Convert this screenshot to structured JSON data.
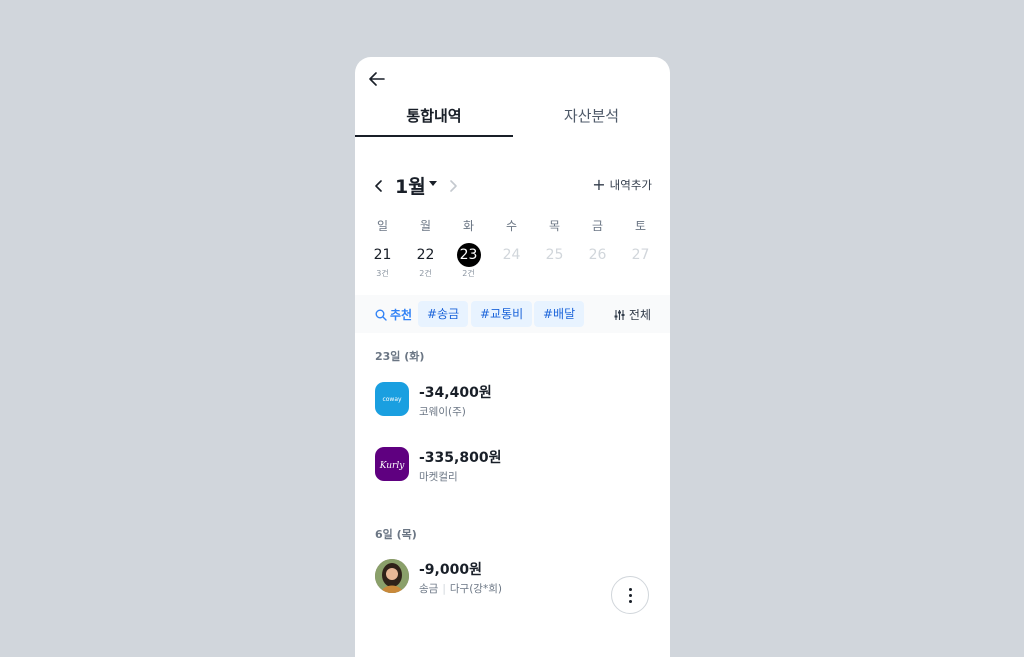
{
  "tabs": [
    {
      "label": "통합내역"
    },
    {
      "label": "자산분석"
    }
  ],
  "month": {
    "label": "1월",
    "add_label": "내역추가"
  },
  "weekdays": [
    "일",
    "월",
    "화",
    "수",
    "목",
    "금",
    "토"
  ],
  "days": [
    {
      "num": "21",
      "count": "3건"
    },
    {
      "num": "22",
      "count": "2건"
    },
    {
      "num": "23",
      "count": "2건"
    },
    {
      "num": "24",
      "count": ""
    },
    {
      "num": "25",
      "count": ""
    },
    {
      "num": "26",
      "count": ""
    },
    {
      "num": "27",
      "count": ""
    }
  ],
  "filters": {
    "recommend": "추천",
    "chips": [
      "#송금",
      "#교통비",
      "#배달"
    ],
    "all": "전체"
  },
  "sections": [
    {
      "date": "23일 (화)",
      "items": [
        {
          "amount": "-34,400원",
          "merchant": "코웨이(주)",
          "logo_text": "coway",
          "logo_color": "#1a9fe0"
        },
        {
          "amount": "-335,800원",
          "merchant": "마켓컬리",
          "logo_text": "Kurly",
          "logo_color": "#5f0080"
        }
      ]
    },
    {
      "date": "6일 (목)",
      "items": [
        {
          "amount": "-9,000원",
          "merchant_type": "송금",
          "merchant": "다구(강*희)"
        }
      ]
    }
  ],
  "colors": {
    "accent": "#3182f6",
    "chip_bg": "#e8f3ff",
    "background": "#d1d6dc"
  }
}
